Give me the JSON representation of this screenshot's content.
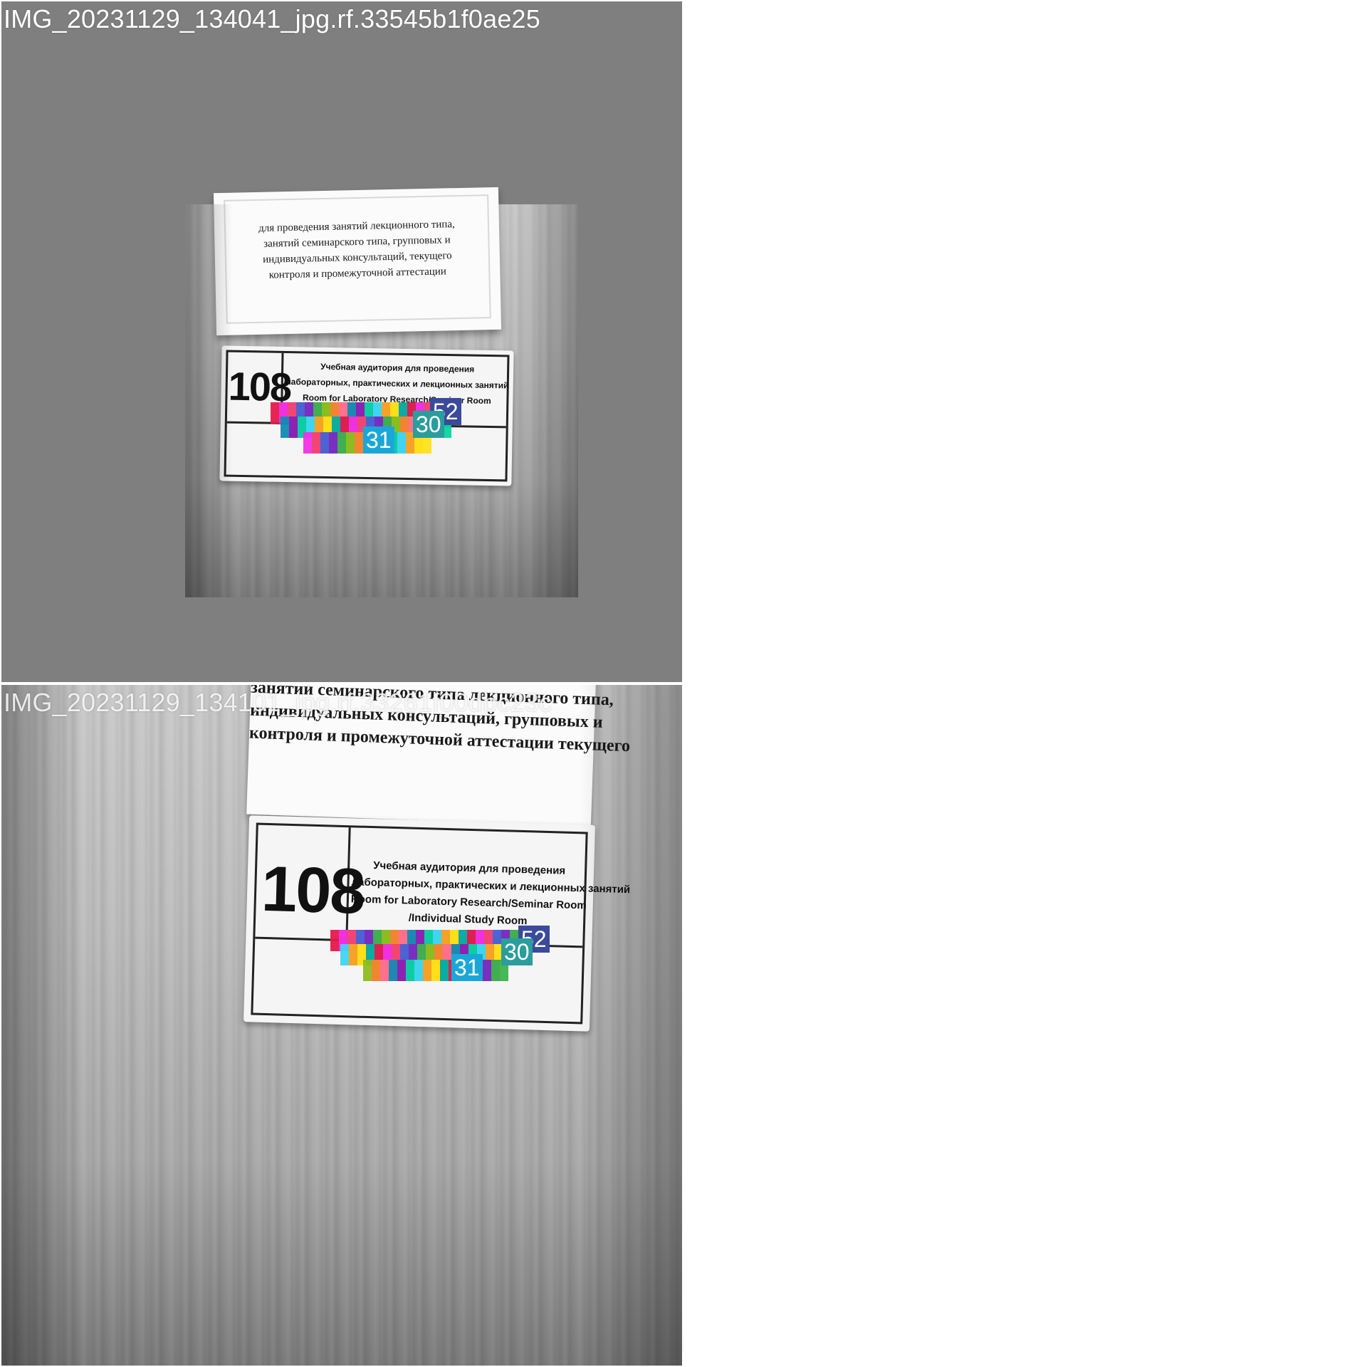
{
  "images": [
    {
      "filename": "IMG_20231129_134041_jpg.rf.33545b1f0ae25",
      "notice_lines": [
        "для проведения занятий лекционного типа,",
        "занятий семинарского типа, групповых и",
        "индивидуальных консультаций, текущего",
        "контроля и промежуточной аттестации"
      ],
      "plate": {
        "room_number": "108",
        "lines": [
          "Учебная аудитория для проведения",
          "лабораторных, практических и лекционных занятий",
          "Room for Laboratory Research/Seminar Room"
        ]
      },
      "labels": [
        {
          "text": "52",
          "color": "#3b4a9b"
        },
        {
          "text": "30",
          "color": "#2a9d9c"
        },
        {
          "text": "31",
          "color": "#1aa7d8"
        }
      ]
    },
    {
      "filename": "IMG_20231129_134101_jpg.rf.33261f00dbc23c",
      "notice_lines": [
        "занятий семинарского типа лекционного типа,",
        "индивидуальных консультаций, групповых и",
        "контроля и промежуточной аттестации текущего"
      ],
      "plate": {
        "room_number": "108",
        "lines": [
          "Учебная аудитория для проведения",
          "лабораторных, практических и лекционных занятий",
          "Room for Laboratory Research/Seminar Room",
          "/Individual Study Room"
        ]
      },
      "labels": [
        {
          "text": "52",
          "color": "#3b4a9b"
        },
        {
          "text": "30",
          "color": "#2a9d9c"
        },
        {
          "text": "31",
          "color": "#1aa7d8"
        }
      ]
    }
  ],
  "palette": [
    "#e6194b",
    "#f58231",
    "#ffe119",
    "#3cb44b",
    "#42d4f4",
    "#4363d8",
    "#911eb4",
    "#f032e6",
    "#ff6f91",
    "#00a8a8",
    "#8fbc1f",
    "#ff9f1c",
    "#7b2cbf",
    "#06d6a0",
    "#ef476f",
    "#118ab2"
  ]
}
